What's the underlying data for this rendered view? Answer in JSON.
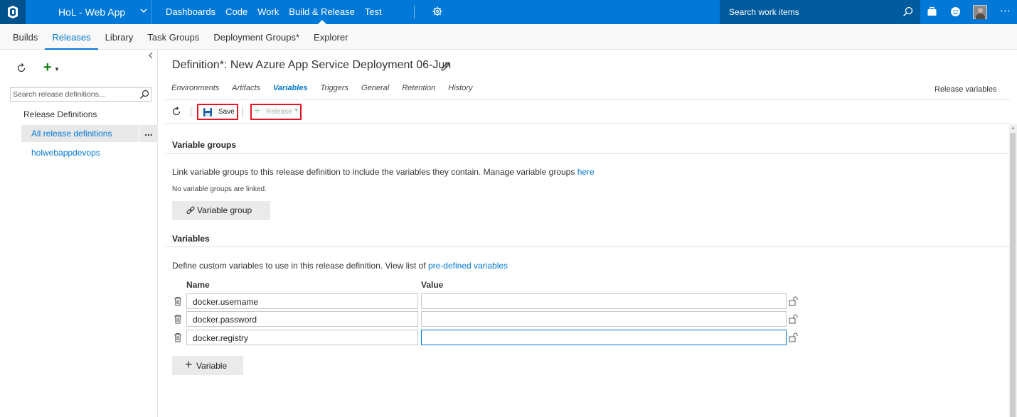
{
  "topbar": {
    "project": "HoL - Web App",
    "nav": [
      "Dashboards",
      "Code",
      "Work",
      "Build & Release",
      "Test"
    ],
    "active_nav_index": 3,
    "search_placeholder": "Search work items",
    "icons": [
      "vsts-logo-icon",
      "chevron-down-icon",
      "gear-icon",
      "search-icon",
      "briefcase-icon",
      "smiley-icon",
      "avatar",
      "more-icon"
    ]
  },
  "subnav": {
    "items": [
      "Builds",
      "Releases",
      "Library",
      "Task Groups",
      "Deployment Groups*",
      "Explorer"
    ],
    "active_index": 1
  },
  "left_pane": {
    "search_placeholder": "Search release definitions...",
    "tree_root": "Release Definitions",
    "selected_item": "All release definitions",
    "more": "...",
    "items": [
      "holwebappdevops"
    ]
  },
  "definition": {
    "title": "Definition*: New Azure App Service Deployment 06-Jun",
    "tabs": [
      "Environments",
      "Artifacts",
      "Variables",
      "Triggers",
      "General",
      "Retention",
      "History"
    ],
    "active_tab_index": 2,
    "right_link": "Release variables"
  },
  "toolbar": {
    "save_label": "Save",
    "release_label": "Release"
  },
  "variable_groups": {
    "heading": "Variable groups",
    "desc_prefix": "Link variable groups to this release definition to include the variables they contain. Manage variable groups ",
    "desc_link": "here",
    "none_text": "No variable groups are linked.",
    "button_label": "Variable group"
  },
  "variables": {
    "heading": "Variables",
    "desc_prefix": "Define custom variables to use in this release definition. View list of ",
    "desc_link": "pre-defined variables",
    "col_name": "Name",
    "col_value": "Value",
    "rows": [
      {
        "name": "docker.username",
        "value": ""
      },
      {
        "name": "docker.password",
        "value": ""
      },
      {
        "name": "docker.registry",
        "value": ""
      }
    ],
    "add_label": "Variable"
  },
  "colors": {
    "accent": "#0078d7",
    "topbar": "#0078d7",
    "highlight_box": "#e81123",
    "add_green": "#107c10"
  }
}
